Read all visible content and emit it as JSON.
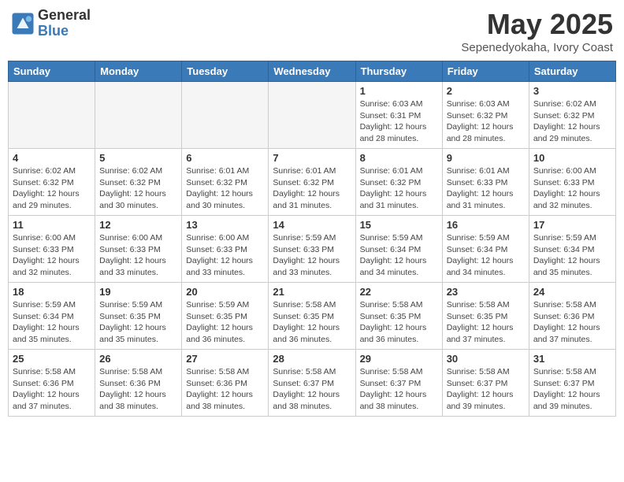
{
  "logo": {
    "general": "General",
    "blue": "Blue"
  },
  "header": {
    "month": "May 2025",
    "location": "Sepenedyokaha, Ivory Coast"
  },
  "weekdays": [
    "Sunday",
    "Monday",
    "Tuesday",
    "Wednesday",
    "Thursday",
    "Friday",
    "Saturday"
  ],
  "weeks": [
    [
      {
        "day": "",
        "info": ""
      },
      {
        "day": "",
        "info": ""
      },
      {
        "day": "",
        "info": ""
      },
      {
        "day": "",
        "info": ""
      },
      {
        "day": "1",
        "info": "Sunrise: 6:03 AM\nSunset: 6:31 PM\nDaylight: 12 hours\nand 28 minutes."
      },
      {
        "day": "2",
        "info": "Sunrise: 6:03 AM\nSunset: 6:32 PM\nDaylight: 12 hours\nand 28 minutes."
      },
      {
        "day": "3",
        "info": "Sunrise: 6:02 AM\nSunset: 6:32 PM\nDaylight: 12 hours\nand 29 minutes."
      }
    ],
    [
      {
        "day": "4",
        "info": "Sunrise: 6:02 AM\nSunset: 6:32 PM\nDaylight: 12 hours\nand 29 minutes."
      },
      {
        "day": "5",
        "info": "Sunrise: 6:02 AM\nSunset: 6:32 PM\nDaylight: 12 hours\nand 30 minutes."
      },
      {
        "day": "6",
        "info": "Sunrise: 6:01 AM\nSunset: 6:32 PM\nDaylight: 12 hours\nand 30 minutes."
      },
      {
        "day": "7",
        "info": "Sunrise: 6:01 AM\nSunset: 6:32 PM\nDaylight: 12 hours\nand 31 minutes."
      },
      {
        "day": "8",
        "info": "Sunrise: 6:01 AM\nSunset: 6:32 PM\nDaylight: 12 hours\nand 31 minutes."
      },
      {
        "day": "9",
        "info": "Sunrise: 6:01 AM\nSunset: 6:33 PM\nDaylight: 12 hours\nand 31 minutes."
      },
      {
        "day": "10",
        "info": "Sunrise: 6:00 AM\nSunset: 6:33 PM\nDaylight: 12 hours\nand 32 minutes."
      }
    ],
    [
      {
        "day": "11",
        "info": "Sunrise: 6:00 AM\nSunset: 6:33 PM\nDaylight: 12 hours\nand 32 minutes."
      },
      {
        "day": "12",
        "info": "Sunrise: 6:00 AM\nSunset: 6:33 PM\nDaylight: 12 hours\nand 33 minutes."
      },
      {
        "day": "13",
        "info": "Sunrise: 6:00 AM\nSunset: 6:33 PM\nDaylight: 12 hours\nand 33 minutes."
      },
      {
        "day": "14",
        "info": "Sunrise: 5:59 AM\nSunset: 6:33 PM\nDaylight: 12 hours\nand 33 minutes."
      },
      {
        "day": "15",
        "info": "Sunrise: 5:59 AM\nSunset: 6:34 PM\nDaylight: 12 hours\nand 34 minutes."
      },
      {
        "day": "16",
        "info": "Sunrise: 5:59 AM\nSunset: 6:34 PM\nDaylight: 12 hours\nand 34 minutes."
      },
      {
        "day": "17",
        "info": "Sunrise: 5:59 AM\nSunset: 6:34 PM\nDaylight: 12 hours\nand 35 minutes."
      }
    ],
    [
      {
        "day": "18",
        "info": "Sunrise: 5:59 AM\nSunset: 6:34 PM\nDaylight: 12 hours\nand 35 minutes."
      },
      {
        "day": "19",
        "info": "Sunrise: 5:59 AM\nSunset: 6:35 PM\nDaylight: 12 hours\nand 35 minutes."
      },
      {
        "day": "20",
        "info": "Sunrise: 5:59 AM\nSunset: 6:35 PM\nDaylight: 12 hours\nand 36 minutes."
      },
      {
        "day": "21",
        "info": "Sunrise: 5:58 AM\nSunset: 6:35 PM\nDaylight: 12 hours\nand 36 minutes."
      },
      {
        "day": "22",
        "info": "Sunrise: 5:58 AM\nSunset: 6:35 PM\nDaylight: 12 hours\nand 36 minutes."
      },
      {
        "day": "23",
        "info": "Sunrise: 5:58 AM\nSunset: 6:35 PM\nDaylight: 12 hours\nand 37 minutes."
      },
      {
        "day": "24",
        "info": "Sunrise: 5:58 AM\nSunset: 6:36 PM\nDaylight: 12 hours\nand 37 minutes."
      }
    ],
    [
      {
        "day": "25",
        "info": "Sunrise: 5:58 AM\nSunset: 6:36 PM\nDaylight: 12 hours\nand 37 minutes."
      },
      {
        "day": "26",
        "info": "Sunrise: 5:58 AM\nSunset: 6:36 PM\nDaylight: 12 hours\nand 38 minutes."
      },
      {
        "day": "27",
        "info": "Sunrise: 5:58 AM\nSunset: 6:36 PM\nDaylight: 12 hours\nand 38 minutes."
      },
      {
        "day": "28",
        "info": "Sunrise: 5:58 AM\nSunset: 6:37 PM\nDaylight: 12 hours\nand 38 minutes."
      },
      {
        "day": "29",
        "info": "Sunrise: 5:58 AM\nSunset: 6:37 PM\nDaylight: 12 hours\nand 38 minutes."
      },
      {
        "day": "30",
        "info": "Sunrise: 5:58 AM\nSunset: 6:37 PM\nDaylight: 12 hours\nand 39 minutes."
      },
      {
        "day": "31",
        "info": "Sunrise: 5:58 AM\nSunset: 6:37 PM\nDaylight: 12 hours\nand 39 minutes."
      }
    ]
  ]
}
